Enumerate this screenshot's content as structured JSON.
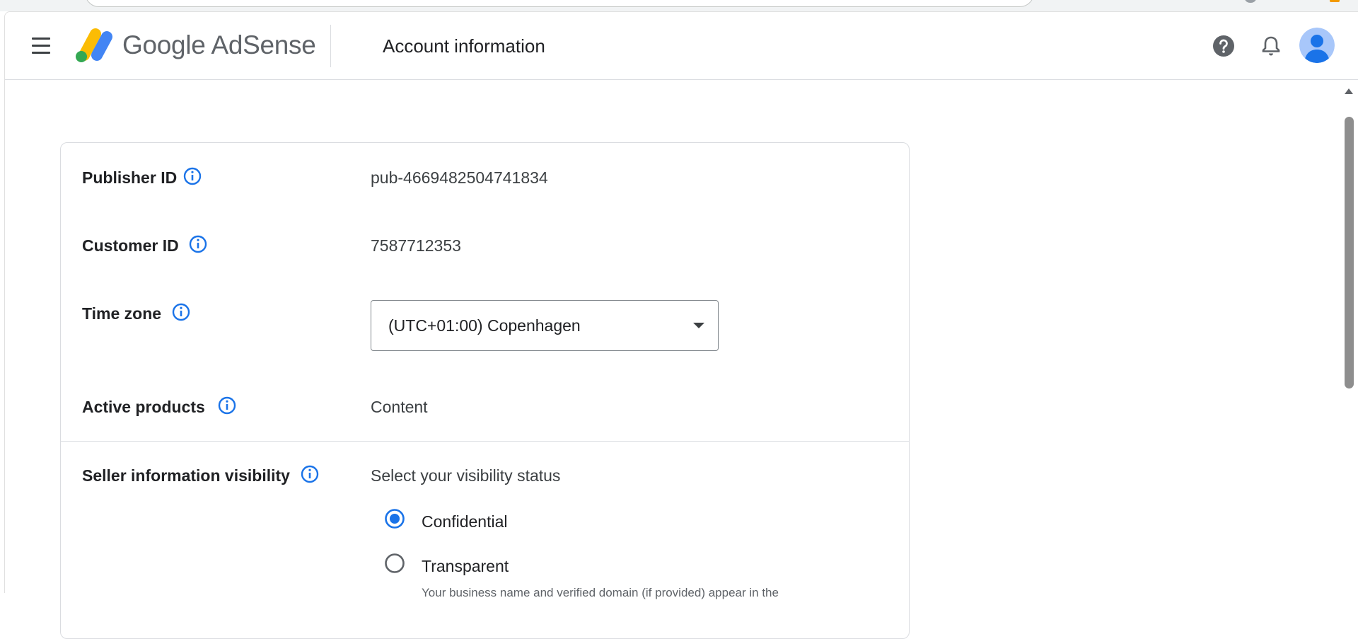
{
  "header": {
    "brand_google": "Google",
    "brand_product": "AdSense",
    "page_title": "Account information"
  },
  "colors": {
    "accent": "#1a73e8",
    "logo_yellow": "#fbbc04",
    "logo_blue": "#4285f4",
    "logo_green": "#34a853"
  },
  "account": {
    "publisher_id": {
      "label": "Publisher ID",
      "value": "pub-4669482504741834",
      "icon": "info-icon"
    },
    "customer_id": {
      "label": "Customer ID",
      "value": "7587712353",
      "icon": "info-icon"
    },
    "time_zone": {
      "label": "Time zone",
      "selected": "(UTC+01:00) Copenhagen",
      "icon": "info-icon"
    },
    "active_products": {
      "label": "Active products",
      "value": "Content",
      "icon": "info-icon"
    }
  },
  "seller": {
    "label": "Seller information visibility",
    "prompt": "Select your visibility status",
    "options": [
      {
        "label": "Confidential",
        "selected": true
      },
      {
        "label": "Transparent",
        "selected": false
      }
    ],
    "transparent_help": "Your business name and verified domain (if provided) appear in the"
  }
}
